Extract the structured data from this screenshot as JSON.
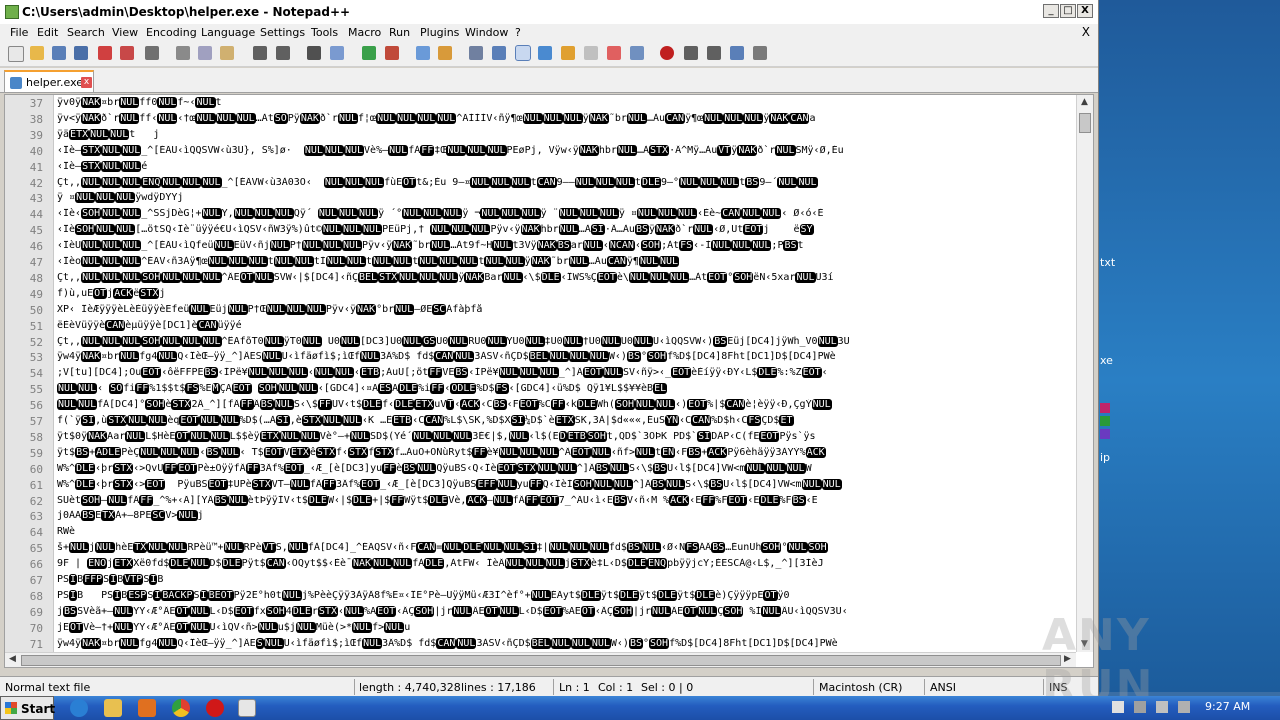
{
  "window": {
    "title": "C:\\Users\\admin\\Desktop\\helper.exe - Notepad++",
    "controls": {
      "minimize": "_",
      "maximize": "□",
      "close": "X"
    }
  },
  "menu": {
    "items": [
      "File",
      "Edit",
      "Search",
      "View",
      "Encoding",
      "Language",
      "Settings",
      "Tools",
      "Macro",
      "Run",
      "Plugins",
      "Window",
      "?"
    ],
    "close": "X"
  },
  "tab": {
    "label": "helper.exe",
    "close": "x"
  },
  "editor": {
    "line_numbers": [
      "37",
      "38",
      "39",
      "40",
      "41",
      "42",
      "43",
      "44",
      "45",
      "46",
      "47",
      "48",
      "49",
      "50",
      "51",
      "52",
      "53",
      "54",
      "55",
      "56",
      "57",
      "58",
      "59",
      "60",
      "61",
      "62",
      "63",
      "64",
      "65",
      "66",
      "67",
      "68",
      "69",
      "70",
      "71"
    ],
    "lines": [
      "ÿv0ÿ[NAK]¤br[NUL]ff0[NUL]f~‹[NUL]t",
      "ÿv<ÿ[NAK]ð`r[NUL]ff‹[NUL]‹†œ[NUL][NUL][NUL]…Àt[SO]Pÿ[NAK]ð`r[NUL]f¦œ[NUL][NUL][NUL][NUL]^ÃÌÌÌV‹ñÿ¶œ[NUL][NUL][NUL]ÿ[NAK]˜br[NUL]…Àu[CAN]ÿ¶œ[NUL][NUL][NUL]ÿ[NAK][CAN]a",
      "ÿä[ETX][NUL][NUL]t   j",
      "‹Îè–[STX][NUL][NUL]_^[ÉÃU‹ìQQSVW‹ù3Û}, S%]ø·  [NUL][NUL][NUL]Vè%–[NUL]fÀ[FF]‡Œ[NUL][NUL][NUL]PEøPj, Vÿw‹ÿ[NAK]hbr[NUL]…À[STX]·Â^Mÿ…Àu[VT]ÿ[NAK]ð`r[NUL]ŠMÿ‹Ø,Éu",
      "‹Îè–[STX][NUL][NUL]é",
      "Çt,,[NUL][NUL][NUL][ENQ][NUL][NUL][NUL]_^[ÉÃVW‹ù3À03Ò‹  [NUL][NUL][NUL]fùE[OT]t&;Èu 9–¤[NUL][NUL][NUL]t[CAN]9––[NUL][NUL][NUL]t[DLE]9–°[NUL][NUL][NUL]t[BS]9–´[NUL][NUL]",
      "ÿ ¤[NUL][NUL][NUL]ÿwdÿDYYj",
      "‹Îè‹[SOH][NUL][NUL]_^ŠSjDèG¦+[NUL]Y,[NUL][NUL][NUL]Qÿ´ [NUL][NUL][NUL]ÿ ´°[NUL][NUL][NUL]ÿ ¬[NUL][NUL][NUL]ÿ ¨[NUL][NUL][NUL]ÿ ¤[NUL][NUL][NUL]‹Èè~[CAN][NUL][NUL]‹ Ø‹ó‹È",
      "‹Îè[SOH][NUL][NUL][…ötŠQ‹Îè¨üÿÿé€U‹ìQSV‹ñW3ÿ%)ût©[NUL][NUL][NUL]PEüPj,† [NUL][NUL][NUL]Pÿv‹ÿ[NAK]hbr[NUL]…À[SI]·Â…Àu[BS]ÿ[NAK]ð`r[NUL]‹Ø,Út[EOT]j    ë[SY]",
      "‹ÎèÛ[NUL][NUL][NUL]_^[ÉÃU‹ìQfeü[NUL]EüV‹ñj[NUL]P†[NUL][NUL][NUL]Pÿv‹ÿ[NAK]˜br[NUL]…Àt9f~H[NUL]t3Vÿ[NAK][BS]ar[NUL]‹[NCAN]‹[SOH];Àt[FS]‹-Ì[NUL][NUL][NUL];P[BS]t",
      "‹Îèo[NUL][NUL][NUL]^ÉÃV‹ñ3Àÿ¶œ[NUL][NUL][NUL]t[NUL][NUL]tÌ[NUL][NUL]t[NUL][NUL]t[NUL][NUL][NUL]t[NUL][NUL]ÿ[NAK]˜br[NUL]…Àu[CAN]ÿ¶[NUL][NUL]",
      "Çt,,[NUL][NUL][NUL][SOH][NUL][NUL][NUL]^ÂE[OT][NUL]SVW‹|$[DC4]‹ñÇ[BEL][STX][NUL][NUL][NUL]ÿ[NAK]Bar[NUL]‹\\$[DLE]‹ÎWS%Ç[EOT]è\\[NUL][NUL][NUL]…Àt[EOT]°[SOH]ëN‹5xar[NUL]U3í",
      "f)ù,uE[OT]j[ACK]ë[STX]j",
      "XP‹ ÎèÆÿÿÿèLèÈüÿÿèEfeü[NUL]Eüj[NUL]P†Œ[NUL][NUL][NUL]Pÿv‹ÿ[NAK]°br[NUL]–ØE[SC]Àfàþfå",
      "ëÈèVüÿÿè[CAN]èµüÿÿè[DC1]è[CAN]üÿÿé",
      "Çt,,[NUL][NUL][NUL][SOH][NUL][NUL][NUL]^ÊÄfõT0[NUL]ÿT0[NUL] U0[NUL][DC3]U0[NUL][GS]U0[NUL]RU0[NUL]YU0[NUL]‡U0[NUL]†U0[NUL]U0[NUL]U‹ìQQSVW‹)[BS]Eüj[DC4]jÿWh_V0[NUL]3Û",
      "ÿw4ÿ[NAK]¤br[NUL]fg4[NUL]Q‹ÎèŒ–ÿÿ_^]ÂES[NUL]U‹ìfäøfì$;ìŒf[NUL]3Â%D$ fd$[CAN][NUL]3ÀSV‹ñÇD$[BEL][NUL][NUL][NUL]W‹)[BS]°[SOH]f%D$[DC4]8Fht[DC1]D$[DC4]PWè",
      ";V[tu][DC4];Óu[EOT]‹ôëFFPE[BS]‹ÌPë¥[NUL][NUL][NUL]‹[NUL][NUL]‹[ETB];ÀuÛ[;öt[FF]VE[BS]‹ÌPë¥[NUL][NUL][NUL]_^]Â[EOT][NUL]SV‹ñÿ>‹_[EOT]èÈíÿÿ‹ÐY‹L$[DLE]%:%Z[EOT]‹",
      "[NUL][NUL]‹ [SO]fi[FF]%1$$t$[FS]%E[M]ÇA[EOT] [SOH][NUL][NUL]‹[GDC4]‹¤A[ES]A[DLE]%i[FF]‹[ODLE]%D$[FS]‹[GDC4]‹ü%D$ Qÿ1¥L$$¥¥èB[EL]",
      "[NUL][NUL]fÀ[DC4]°[SOH]è[STX]2Â_^][fÂ[FF]Â[BS][NUL]S‹\\$[FF]UV‹t$[DLE]f‹[DLE][ETX]uV[T]‹[ACK]‹C[BS]‹F[EOT]%C[FF]‹k[DLE]Wh([SOH][NUL][NUL]‹)[EOT]%|$[CAN]è¦èÿÿ‹Ð,ÇgÝ[NUL]",
      "f(`ÿ[SI],ù[STX][NUL][NUL]èq[EOT][NUL][NUL]%D$(…À[SI],è[STX][NUL][NUL]‹K …Ê[ETB]‹C[CAN]%L$\\ŠK,%D$X[SI]¼D$`è[ETX]ŠK,3À|$d«««,ÉuS[YN]‹C[CAN]%D$h‹C[FS]ÇD$[ET]",
      "ÿt$0ÿ[NAK]Äar[NUL]L$HèE[OT][NUL][NUL]L$$èÿ[ETX][NUL][NUL]Vè°–+[NUL]ŠD$(Yé´[NUL][NUL][NUL]3É€|$,[NUL]‹l$(E[D][ETB][SOH]t,QD$`3ÒÞK PD$`[SI]DÂP‹C(fE[EOT]Pÿs`ÿs",
      "ÿt$[BS]+[ADLE]PèÇ[NUL][NUL][NUL]‹[BS][NUL]‹ T$[EOT]V[ETX]ê[STX]f‹[STX]f[STX]f…ÀuÔ+ÓÑùRyt$[FF]è¥[NUL][NUL][NUL]^Â[EOT][NUL]‹ñf>[NUL]t[EN]‹F[BS]+[ACK]Pÿ6èhäÿÿ3ÀYÝ%[ACK]",
      "W%^[DLE]‹þr[STX]‹>QvU[FF][EOT]Pè±ÕÿÿfÂ[FF]3Âf%[EOT]_‹Æ_[è[DC3]yu[FF]è[BS][NUL]QÿuBS‹Q‹Îè[EOT][STX][NUL][NUL]^]Â[BS][NUL]S‹\\$[BS]U‹l$[DC4]VW<m[NUL][NUL][NUL]W",
      "W%^[DLE]‹þr[STX]‹>[EOT]  PÿuBS[EOT]‡UPè[STX]VT–[NUL]fÂ[FF]3Âf%[EOT]_‹Æ_[è[DC3]QÿuBS[EFF][NUL]yu[FF]Q‹ÎèÌ[SOH][NUL][NUL]^]Â[BS][NUL]S‹\\$[BS]U‹l$[DC4]VW<m[NUL][NUL]",
      "SUèt[SOH]–[NUL]fÂ[FF]_^%+‹Ã][YÂ[BS][NUL]ètÞÿÿÌV‹t$[DLE]W‹|$[DLE]+|$[FF]Wÿt$[DLE]Vè,[ACK]–[NUL]fÂ[FF][EOT]7_^ÃU‹ì‹E[BS]V‹ñ‹M %[ACK]‹E[FF]%F[EOT]‹E[DLE]%F[BS]‹E",
      "j0ÀA[BS]E[TX]À+–8PE[SC]V>[NUL]j",
      "RWè",
      "š+[NUL]j[NUL]hèE[TX][NUL][NUL]RPèü™+[NUL]RPè[VT]Š,[NUL]fÀ[DC4]_^ÉÃQSV‹ñ‹F[CAN]=[NUL][DLE][NUL][NUL][SI]‡|[NUL][NUL][NUL]fd$[BS][NUL]‹Ø‹N[FS]ÁÂ[BS]…ÉunUh[SOH]°[NUL][SOH]",
      "9F | [ENO]j[ETX]Xë0fd$[DLE][NUL]D$[DLE]Pÿt$[CAN]‹ÕQyt$$‹Èè¯[NAK][NUL][NUL]fÀ[DLE],ÀtFW‹ ÎèÂ[NUL][NUL][NUL]j[STX]è‡L‹D$[DLE][ENQ]pbÿÿjcY;ÈESCÀ@‹L$,_^][3ÌèJ",
      "PS[I]B[FFP]S[I]B[VTP]S[I]B",
      "PS[I]B   PS[I]B[ESP]S[I][BACKP]S[I][BEOT]Pÿ2E°h0t[NUL]j%PèèÇÿÿ3ÀÿÂ8f%E¤‹ÎE°Pè–ÜÿÿMü‹Æ3Ì^èf°+[NUL]ÉÃyt$[DLE]ÿt$[DLE]ÿt$[DLE]ÿt$[DLE]è)ÇÿÿÿpE[OT]ÿ0",
      "j[BS]SVèã+–[NUL]YY‹Æ°ÂE[OT][NUL]L‹D$[EOT]fx[SOH]4[DLE]r[STX]‹[NUL]%A[EOT]‹ÂÇ[SOH]|jr[NUL]ÂE[OT][NUL]L‹D$[EOT]%AE[OT]‹ÂÇ[SOH]|jr[NUL]ÂE[OT][NUL]Ç[SOH] %Ì[NUL]ÂU‹ìQQSV3Û‹",
      "jE[OT]Vè–†+[NUL]YY‹Æ°ÂE[OT][NUL]U‹ìQV‹ñ>[NUL]u$j[NUL]Müè(>*[NUL]f>[NUL]u",
      "ÿw4ÿ[NAK]¤br[NUL]fg4[NUL]Q‹ÎèŒ–ÿÿ_^]ÂE[S][NUL]U‹ìfäøfì$;ìŒf[NUL]3Â%D$ fd$[CAN][NUL]3ÀSV‹ñÇD$[BEL][NUL][NUL][NUL]W‹)[BS]°[SOH]f%D$[DC4]8Fht[DC1]D$[DC4]PWè"
    ]
  },
  "status": {
    "type": "Normal text file",
    "length": "length : 4,740,328",
    "lines": "lines : 17,186",
    "ln": "Ln : 1",
    "col": "Col : 1",
    "sel": "Sel : 0 | 0",
    "eol": "Macintosh (CR)",
    "encoding": "ANSI",
    "mode": "INS"
  },
  "taskbar": {
    "start": "Start",
    "clock": "9:27 AM"
  },
  "desktop": {
    "labels": [
      "txt",
      "xe",
      "ip"
    ]
  },
  "watermark": "ANY RUN",
  "colors": {
    "title_text": "#000000",
    "tab_accent": "#f5a030",
    "taskbar": "#245dbf",
    "control_char_bg": "#000000"
  }
}
